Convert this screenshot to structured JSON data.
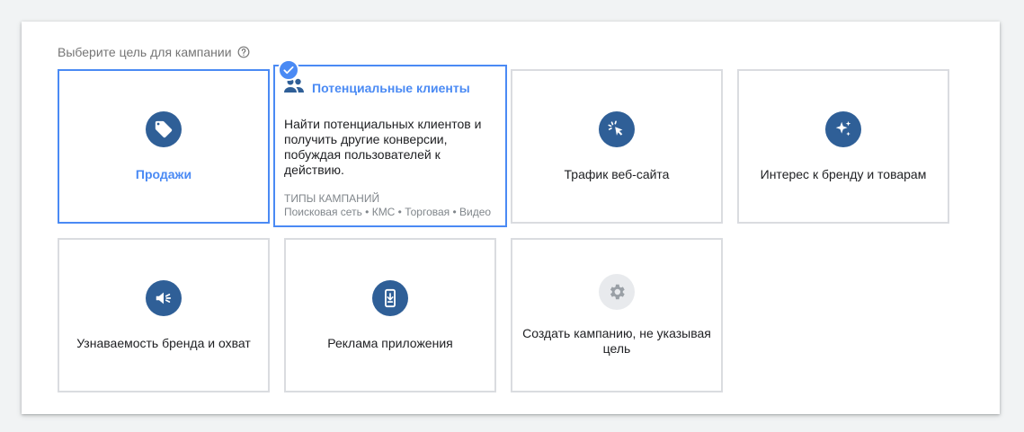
{
  "header": {
    "title": "Выберите цель для кампании",
    "help_icon": "help-circle-icon"
  },
  "colors": {
    "accent": "#4a8af4",
    "icon_bg": "#2f5f97",
    "border": "#dadce0"
  },
  "goals": {
    "sales": {
      "label": "Продажи",
      "icon": "tag-icon",
      "selected": true
    },
    "leads": {
      "title": "Потенциальные клиенты",
      "icon": "people-icon",
      "description": "Найти потенциальных клиентов и получить другие конверсии, побуждая пользователей к действию.",
      "types_label": "ТИПЫ КАМПАНИЙ",
      "types": "Поисковая сеть • КМС • Торговая • Видео"
    },
    "traffic": {
      "label": "Трафик веб-сайта",
      "icon": "cursor-click-icon"
    },
    "brand_consideration": {
      "label": "Интерес к бренду и товарам",
      "icon": "sparkle-icon"
    },
    "awareness": {
      "label": "Узнаваемость бренда и охват",
      "icon": "speaker-icon"
    },
    "app": {
      "label": "Реклама приложения",
      "icon": "phone-download-icon"
    },
    "no_goal": {
      "label": "Создать кампанию, не указывая цель",
      "icon": "gear-icon"
    }
  }
}
